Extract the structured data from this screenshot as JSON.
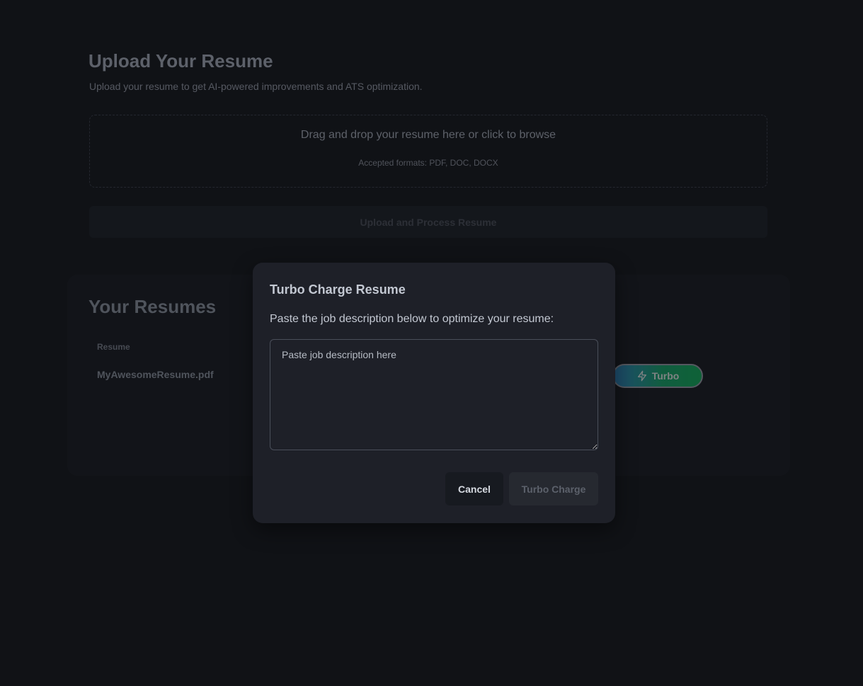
{
  "upload": {
    "title": "Upload Your Resume",
    "subtitle": "Upload your resume to get AI-powered improvements and ATS optimization.",
    "dropzone_text": "Drag and drop your resume here or click to browse",
    "accepted_formats": "Accepted formats: PDF, DOC, DOCX",
    "button_label": "Upload and Process Resume"
  },
  "resumes": {
    "title": "Your Resumes",
    "column_header": "Resume",
    "rows": [
      {
        "name": "MyAwesomeResume.pdf",
        "turbo_label": "Turbo"
      }
    ]
  },
  "modal": {
    "title": "Turbo Charge Resume",
    "instructions": "Paste the job description below to optimize your resume:",
    "textarea_placeholder": "Paste job description here",
    "textarea_value": "",
    "cancel_label": "Cancel",
    "submit_label": "Turbo Charge"
  },
  "icons": {
    "turbo": "lightning-bolt-icon"
  }
}
